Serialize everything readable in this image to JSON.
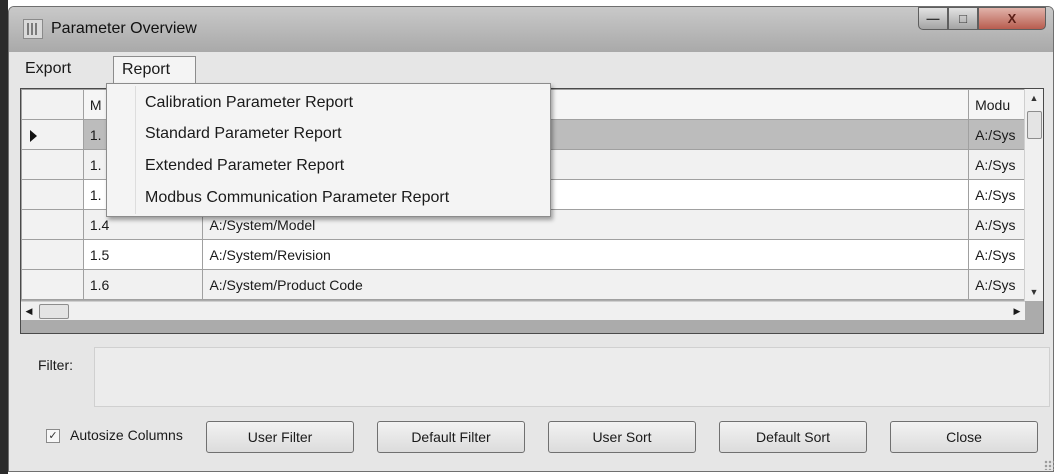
{
  "window": {
    "title": "Parameter Overview",
    "controls": {
      "minimize": "—",
      "maximize": "□",
      "close": "X"
    }
  },
  "menubar": {
    "items": [
      {
        "label": "Export"
      },
      {
        "label": "Report"
      }
    ]
  },
  "report_menu": {
    "items": [
      {
        "label": "Calibration Parameter Report"
      },
      {
        "label": "Standard Parameter Report"
      },
      {
        "label": "Extended Parameter Report"
      },
      {
        "label": "Modbus Communication Parameter Report"
      }
    ]
  },
  "grid": {
    "columns": [
      "M",
      "",
      "Modu"
    ],
    "rows": [
      {
        "c1": "1.",
        "c2": "",
        "c3": "A:/Sys",
        "current": true
      },
      {
        "c1": "1.",
        "c2": "",
        "c3": "A:/Sys"
      },
      {
        "c1": "1.",
        "c2": "",
        "c3": "A:/Sys"
      },
      {
        "c1": "1.4",
        "c2": "A:/System/Model",
        "c3": "A:/Sys"
      },
      {
        "c1": "1.5",
        "c2": "A:/System/Revision",
        "c3": "A:/Sys"
      },
      {
        "c1": "1.6",
        "c2": "A:/System/Product Code",
        "c3": "A:/Sys"
      }
    ]
  },
  "filter": {
    "label": "Filter:",
    "value": ""
  },
  "footer": {
    "autosize_label": "Autosize Columns",
    "autosize_checked": true,
    "buttons": {
      "user_filter": "User Filter",
      "default_filter": "Default Filter",
      "user_sort": "User Sort",
      "default_sort": "Default Sort",
      "close": "Close"
    }
  }
}
